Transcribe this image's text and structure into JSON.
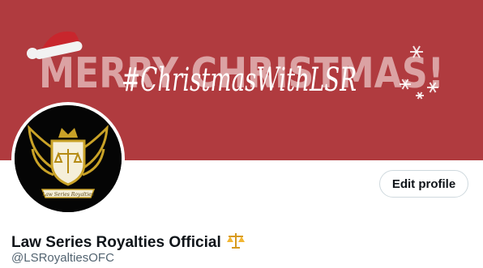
{
  "banner": {
    "background_color": "#b03b3f",
    "greeting": "MERRY CHRISTMAS!",
    "hashtag": "#ChristmasWithLSR"
  },
  "avatar": {
    "ribbon_text": "Law Series Royalties"
  },
  "profile": {
    "edit_button_label": "Edit profile",
    "display_name": "Law Series Royalties Official",
    "handle": "@LSRoyaltiesOFC"
  },
  "icons": {
    "verified_emoji": "scales-icon",
    "hat": "santa-hat-icon"
  },
  "colors": {
    "text_primary": "#0f1419",
    "text_secondary": "#536471",
    "border": "#cfd9de",
    "gold": "#c9a227"
  }
}
